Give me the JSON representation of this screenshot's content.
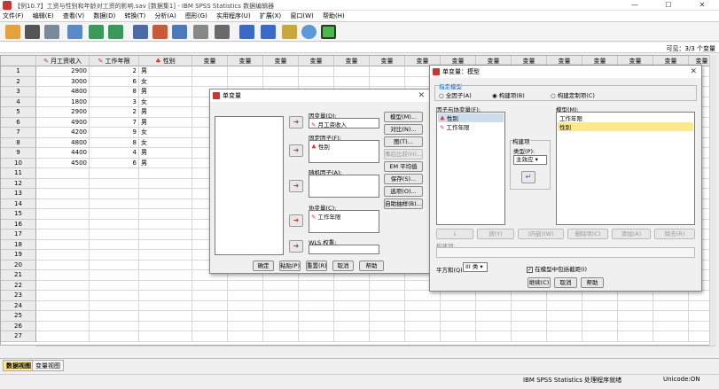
{
  "window": {
    "title": "【例10.7】工资与性别和年龄对工资的影响.sav [数据集1] - IBM SPSS Statistics 数据编辑器",
    "min": "—",
    "max": "☐",
    "close": "✕"
  },
  "menu": [
    "文件(F)",
    "编辑(E)",
    "查看(V)",
    "数据(D)",
    "转换(T)",
    "分析(A)",
    "图形(G)",
    "实用程序(U)",
    "扩展(X)",
    "窗口(W)",
    "帮助(H)"
  ],
  "varcount": "可见：3/3 个变量",
  "columns": [
    "月工资收入",
    "工作年限",
    "性别",
    "变量",
    "变量",
    "变量",
    "变量",
    "变量",
    "变量",
    "变量",
    "变量",
    "变量",
    "变量",
    "变量",
    "变量",
    "变量",
    "变量",
    "变量",
    "变量"
  ],
  "rows": [
    {
      "n": "1",
      "salary": "2900",
      "years": "2",
      "gender": "男"
    },
    {
      "n": "2",
      "salary": "3000",
      "years": "6",
      "gender": "女"
    },
    {
      "n": "3",
      "salary": "4800",
      "years": "8",
      "gender": "男"
    },
    {
      "n": "4",
      "salary": "1800",
      "years": "3",
      "gender": "女"
    },
    {
      "n": "5",
      "salary": "2900",
      "years": "2",
      "gender": "男"
    },
    {
      "n": "6",
      "salary": "4900",
      "years": "7",
      "gender": "男"
    },
    {
      "n": "7",
      "salary": "4200",
      "years": "9",
      "gender": "女"
    },
    {
      "n": "8",
      "salary": "4800",
      "years": "8",
      "gender": "女"
    },
    {
      "n": "9",
      "salary": "4400",
      "years": "4",
      "gender": "男"
    },
    {
      "n": "10",
      "salary": "4500",
      "years": "6",
      "gender": "男"
    },
    {
      "n": "11"
    },
    {
      "n": "12"
    },
    {
      "n": "13"
    },
    {
      "n": "14"
    },
    {
      "n": "15"
    },
    {
      "n": "16"
    },
    {
      "n": "17"
    },
    {
      "n": "18"
    },
    {
      "n": "19"
    },
    {
      "n": "20"
    },
    {
      "n": "21"
    },
    {
      "n": "22"
    },
    {
      "n": "23"
    },
    {
      "n": "24"
    },
    {
      "n": "25"
    },
    {
      "n": "26"
    },
    {
      "n": "27"
    }
  ],
  "tabs": {
    "data_view": "数据视图",
    "variable_view": "变量视图"
  },
  "status": {
    "processor": "IBM SPSS Statistics 处理程序就绪",
    "unicode": "Unicode:ON"
  },
  "univariate": {
    "title": "单变量",
    "dependent_label": "因变量(D):",
    "dependent_value": "月工资收入",
    "fixed_label": "固定因子(F):",
    "fixed_value": "性别",
    "random_label": "随机因子(A):",
    "covariate_label": "协变量(C):",
    "covariate_value": "工作年限",
    "wls_label": "WLS 权重:",
    "side_buttons": [
      "模型(M)...",
      "对比(N)...",
      "图(T)...",
      "事后比较(H)...",
      "EM 平均值",
      "保存(S)...",
      "选项(O)...",
      "自助抽样(B)..."
    ],
    "bottom_buttons": [
      "确定",
      "粘贴(P)",
      "重置(R)",
      "取消",
      "帮助"
    ]
  },
  "model": {
    "title": "单变量：模型",
    "spec_label": "指定模型",
    "radios": [
      "全因子(A)",
      "构建项(B)",
      "构建定制项(C)"
    ],
    "factors_label": "因子与协变量(F):",
    "factors": [
      "性别",
      "工作年限"
    ],
    "model_label": "模型(M):",
    "model_items": [
      "工作年限",
      "性别"
    ],
    "build_label": "构建项",
    "type_label": "类型(P):",
    "type_value": "主效应",
    "row_buttons": [
      "↓",
      "按(Y)",
      "(内嵌)(W)",
      "删除项(C)",
      "添加(A)",
      "除去(R)"
    ],
    "term_label": "构建项:",
    "ss_label": "平方和(Q):",
    "ss_value": "III 类",
    "intercept_label": "在模型中包括截距(I)",
    "bottom_buttons": [
      "继续(C)",
      "取消",
      "帮助"
    ]
  }
}
